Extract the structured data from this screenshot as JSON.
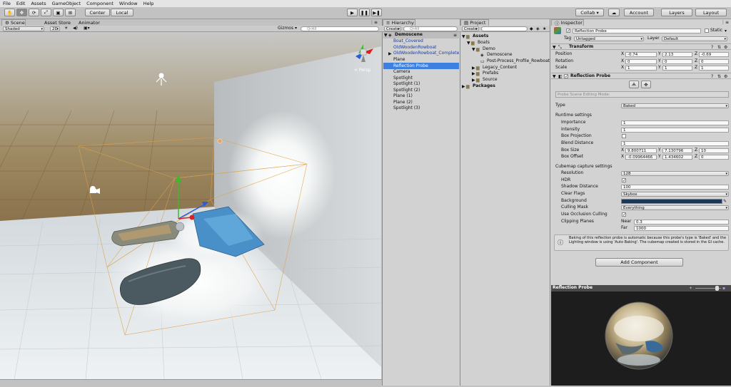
{
  "menu": [
    "File",
    "Edit",
    "Assets",
    "GameObject",
    "Component",
    "Window",
    "Help"
  ],
  "toolbar": {
    "center": "Center",
    "local": "Local",
    "collab": "Collab ▾",
    "account": "Account",
    "layers": "Layers",
    "layout": "Layout"
  },
  "scene_tabs": [
    "Scene",
    "Asset Store",
    "Animator"
  ],
  "scene_bar": {
    "shading": "Shaded",
    "mode2d": "2D",
    "gizmos": "Gizmos ▾",
    "search": "QrAll",
    "persp": "< Persp"
  },
  "hierarchy": {
    "tab": "Hierarchy",
    "create": "Create",
    "search": "QrAll",
    "scene": "Demoscene",
    "items": [
      "Boat_Covered",
      "OldWoodenRowboat",
      "OldWoodenRowboat_Complete",
      "Plane",
      "Reflection Probe",
      "Camera",
      "Spotlight",
      "Spotlight (1)",
      "Spotlight (2)",
      "Plane (1)",
      "Plane (2)",
      "Spotlight (3)"
    ]
  },
  "project": {
    "tab": "Project",
    "create": "Create",
    "items": [
      "Assets",
      "Boats",
      "Demo",
      "Demoscene",
      "Post-Process_Profile_Rowboat",
      "Legacy_Content",
      "Prefabs",
      "Source",
      "Packages"
    ]
  },
  "inspector": {
    "tab": "Inspector",
    "name": "Reflection Probe",
    "static": "Static",
    "tag_label": "Tag",
    "tag": "Untagged",
    "layer_label": "Layer",
    "layer": "Default",
    "transform": {
      "title": "Transform",
      "rows": [
        {
          "label": "Position",
          "x": "-0.74",
          "y": "2.13",
          "z": "-0.69"
        },
        {
          "label": "Rotation",
          "x": "0",
          "y": "0",
          "z": "0"
        },
        {
          "label": "Scale",
          "x": "1",
          "y": "1",
          "z": "1"
        }
      ]
    },
    "probe": {
      "title": "Reflection Probe",
      "edit_mode": "Probe Scene Editing Mode:",
      "type_label": "Type",
      "type": "Baked",
      "runtime": "Runtime settings",
      "importance_label": "Importance",
      "importance": "1",
      "intensity_label": "Intensity",
      "intensity": "1",
      "box_projection": "Box Projection",
      "blend_label": "Blend Distance",
      "blend": "1",
      "box_size_label": "Box Size",
      "box_size": {
        "x": "9.800711",
        "y": "7.130796",
        "z": "10"
      },
      "box_offset_label": "Box Offset",
      "box_offset": {
        "x": "-0.09964466",
        "y": "1.434602",
        "z": "0"
      },
      "cubemap": "Cubemap capture settings",
      "resolution_label": "Resolution",
      "resolution": "128",
      "hdr": "HDR",
      "shadow_label": "Shadow Distance",
      "shadow": "100",
      "clear_label": "Clear Flags",
      "clear": "Skybox",
      "bg_label": "Background",
      "culling_label": "Culling Mask",
      "culling": "Everything",
      "occlusion": "Use Occlusion Culling",
      "clip_label": "Clipping Planes",
      "near_label": "Near",
      "near": "0.3",
      "far_label": "Far",
      "far": "1000",
      "info": "Baking of this reflection probe is automatic because this probe's type is 'Baked' and the Lighting window is using 'Auto Baking'. The cubemap created is stored in the GI cache."
    },
    "add_component": "Add Component",
    "preview_title": "Reflection Probe"
  },
  "colors": {
    "selection": "#3d80df",
    "blue_text": "#1c3f9e",
    "bg_swatch": "#1d3557"
  }
}
